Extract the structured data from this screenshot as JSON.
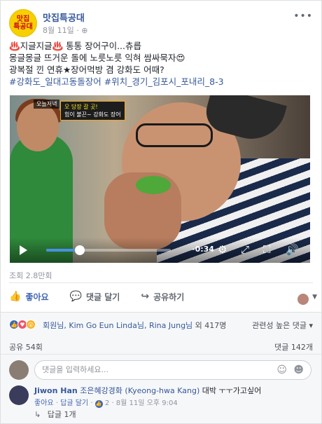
{
  "post": {
    "page_logo_line1": "맛집",
    "page_logo_line2": "특공대",
    "page_name": "맛집특공대",
    "date": "8월 11일",
    "privacy_icon": "globe-icon",
    "text_line1": "♨️지글지글♨️ 통통 장어구이...츄릅",
    "text_line2": "몽글몽글 뜨거운 돌에 노릇노릇 익혀 쌈싸묵자😍",
    "text_line3": "광복절 낀 연휴★장어먹방 겸 강화도 어때?",
    "hashtags": "#강화도_일대고동돌장어 #위치_경기_김포시_포내리_8-3"
  },
  "video": {
    "overlay_tag": "오늘저녁",
    "overlay_caption_line1": "오 당장 갈 곳!",
    "overlay_caption_line2": "힘이 불끈~ 강화도 장어",
    "time_remaining": "-0:34",
    "progress": 0.27
  },
  "views": "조회 2.8만회",
  "actions": {
    "like": "좋아요",
    "comment": "댓글 달기",
    "share": "공유하기"
  },
  "reactions": {
    "names": "회원님, Kim Go Eun Linda님, Rina Jung님",
    "others": "외 417명",
    "sort": "관련성 높은 댓글"
  },
  "counts": {
    "shares": "공유 54회",
    "comments": "댓글 142개"
  },
  "comment_input": {
    "placeholder": "댓글을 입력하세요..."
  },
  "comment": {
    "author": "Jiwon Han",
    "tagged": "조은혜강경화 (Kyeong-hwa Kang)",
    "text": "대박 ㅜㅜ가고싶어",
    "like_label": "좋아요",
    "reply_label": "답글 달기",
    "like_count": "2",
    "timestamp": "8월 11일 오후 9:04"
  },
  "replies": {
    "label": "답글 1개"
  },
  "colors": {
    "link": "#365899",
    "accent": "#4267b2",
    "muted": "#90949c"
  }
}
